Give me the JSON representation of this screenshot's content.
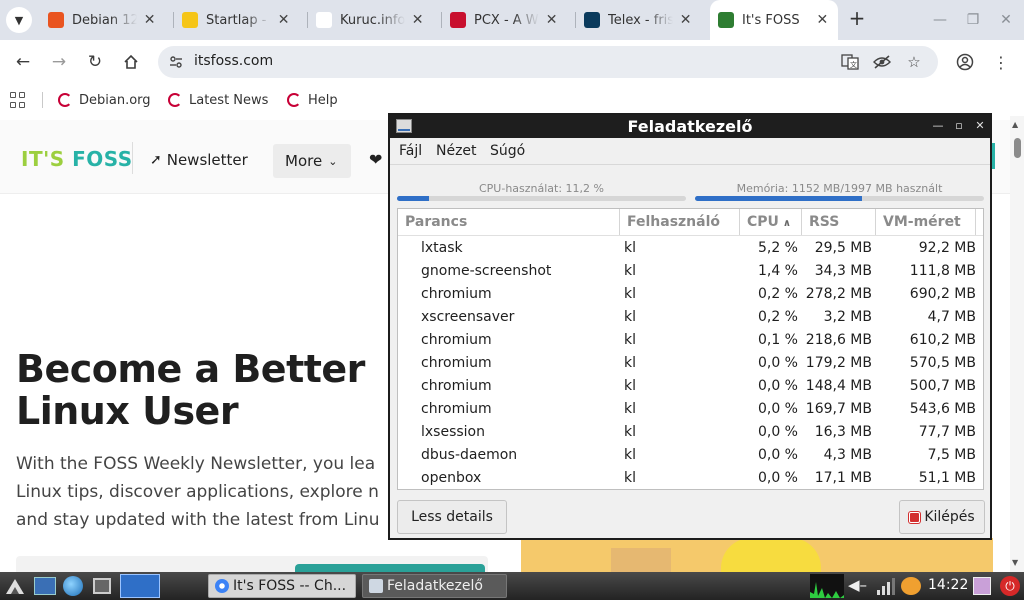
{
  "browser": {
    "tabs": [
      {
        "title": "Debian 12",
        "favicon_color": "#e95420",
        "favicon_glyph": "ubuntu-icon",
        "active": false
      },
      {
        "title": "Startlap -",
        "favicon_color": "#f5c518",
        "favicon_glyph": "startlap-icon",
        "active": false
      },
      {
        "title": "Kuruc.info",
        "favicon_color": "#ffffff",
        "favicon_glyph": "kuruc-icon",
        "active": false
      },
      {
        "title": "PCX - A W",
        "favicon_color": "#c8102e",
        "favicon_glyph": "pcx-icon",
        "active": false
      },
      {
        "title": "Telex - friss",
        "favicon_color": "#0a3a5c",
        "favicon_glyph": "telex-icon",
        "active": false
      },
      {
        "title": "It's FOSS",
        "favicon_color": "#2e7d32",
        "favicon_glyph": "itsfoss-icon",
        "active": true
      }
    ],
    "url": "itsfoss.com",
    "bookmarks": [
      {
        "label": "Debian.org"
      },
      {
        "label": "Latest News"
      },
      {
        "label": "Help"
      }
    ]
  },
  "site": {
    "logo_its": "IT'S",
    "logo_foss": "FOSS",
    "nav_newsletter": "Newsletter",
    "nav_more": "More",
    "hero_title_line1": "Become a Better",
    "hero_title_line2": "Linux User",
    "hero_sub_line1": "With the FOSS Weekly Newsletter, you lea",
    "hero_sub_line2": "Linux tips, discover applications, explore n",
    "hero_sub_line3": "and stay updated with the latest from Linu",
    "accent": "#27b2a7"
  },
  "taskmgr": {
    "title": "Feladatkezelő",
    "menu": {
      "file": "Fájl",
      "view": "Nézet",
      "help": "Súgó"
    },
    "cpu_label": "CPU-használat: 11,2 %",
    "cpu_fraction": 0.112,
    "mem_label": "Memória: 1152 MB/1997 MB használt",
    "mem_fraction": 0.577,
    "columns": {
      "command": "Parancs",
      "user": "Felhasználó",
      "cpu": "CPU",
      "rss": "RSS",
      "vm": "VM-méret"
    },
    "processes": [
      {
        "name": "lxtask",
        "user": "kl",
        "cpu": "5,2 %",
        "rss": "29,5 MB",
        "vm": "92,2 MB"
      },
      {
        "name": "gnome-screenshot",
        "user": "kl",
        "cpu": "1,4 %",
        "rss": "34,3 MB",
        "vm": "111,8 MB"
      },
      {
        "name": "chromium",
        "user": "kl",
        "cpu": "0,2 %",
        "rss": "278,2 MB",
        "vm": "690,2 MB"
      },
      {
        "name": "xscreensaver",
        "user": "kl",
        "cpu": "0,2 %",
        "rss": "3,2 MB",
        "vm": "4,7 MB"
      },
      {
        "name": "chromium",
        "user": "kl",
        "cpu": "0,1 %",
        "rss": "218,6 MB",
        "vm": "610,2 MB"
      },
      {
        "name": "chromium",
        "user": "kl",
        "cpu": "0,0 %",
        "rss": "179,2 MB",
        "vm": "570,5 MB"
      },
      {
        "name": "chromium",
        "user": "kl",
        "cpu": "0,0 %",
        "rss": "148,4 MB",
        "vm": "500,7 MB"
      },
      {
        "name": "chromium",
        "user": "kl",
        "cpu": "0,0 %",
        "rss": "169,7 MB",
        "vm": "543,6 MB"
      },
      {
        "name": "lxsession",
        "user": "kl",
        "cpu": "0,0 %",
        "rss": "16,3 MB",
        "vm": "77,7 MB"
      },
      {
        "name": "dbus-daemon",
        "user": "kl",
        "cpu": "0,0 %",
        "rss": "4,3 MB",
        "vm": "7,5 MB"
      },
      {
        "name": "openbox",
        "user": "kl",
        "cpu": "0,0 %",
        "rss": "17,1 MB",
        "vm": "51,1 MB"
      }
    ],
    "less_details_label": "Less details",
    "quit_label": "Kilépés"
  },
  "panel": {
    "tasks": [
      {
        "label": "It's FOSS -- Ch..."
      },
      {
        "label": "Feladatkezelő"
      }
    ],
    "clock": "14:22"
  }
}
